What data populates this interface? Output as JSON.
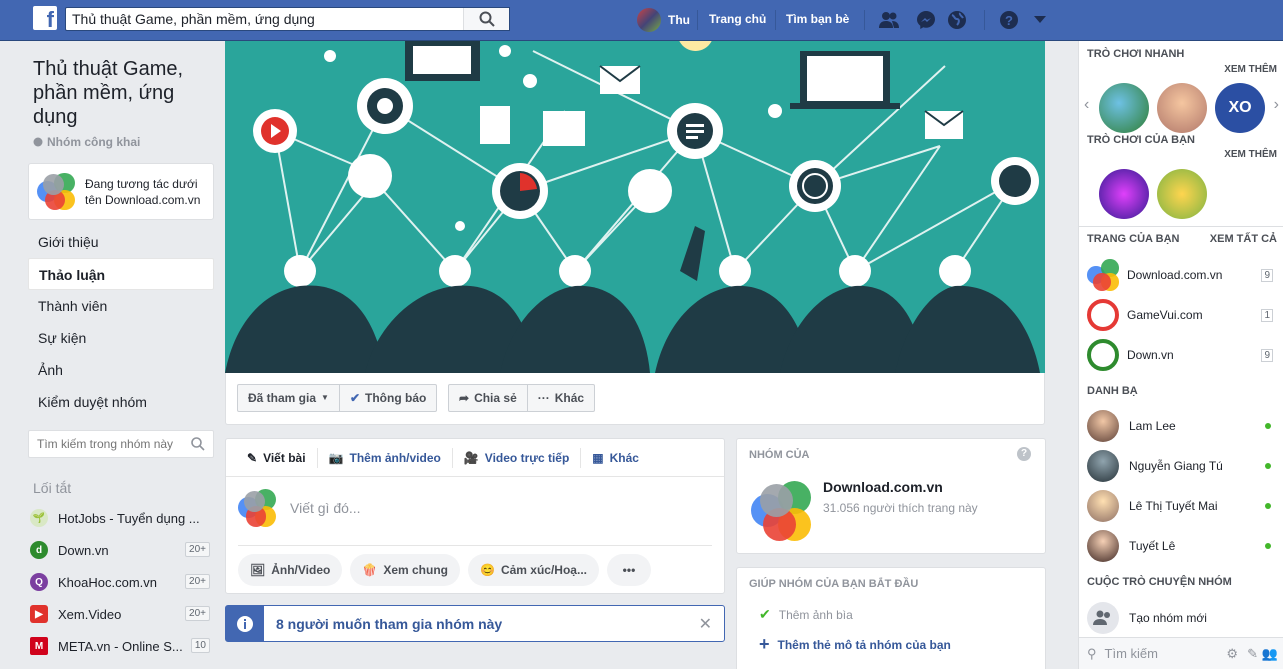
{
  "header": {
    "search_value": "Thủ thuật Game, phần mềm, ứng dụng",
    "user_name": "Thu",
    "home_label": "Trang chủ",
    "find_friends_label": "Tìm bạn bè"
  },
  "group": {
    "title": "Thủ thuật Game, phần mềm, ứng dụng",
    "privacy": "Nhóm công khai",
    "acting_as": "Đang tương tác dưới tên Download.com.vn"
  },
  "left_nav": [
    "Giới thiệu",
    "Thảo luận",
    "Thành viên",
    "Sự kiện",
    "Ảnh",
    "Kiểm duyệt nhóm"
  ],
  "left_search_placeholder": "Tìm kiếm trong nhóm này",
  "shortcuts": {
    "title": "Lối tắt",
    "items": [
      {
        "label": "HotJobs - Tuyển dụng ...",
        "badge": ""
      },
      {
        "label": "Down.vn",
        "badge": "20+"
      },
      {
        "label": "KhoaHoc.com.vn",
        "badge": "20+"
      },
      {
        "label": "Xem.Video",
        "badge": "20+"
      },
      {
        "label": "META.vn - Online S...",
        "badge": "10"
      }
    ]
  },
  "cover_actions": {
    "joined": "Đã tham gia",
    "notifications": "Thông báo",
    "share": "Chia sẻ",
    "more": "Khác"
  },
  "composer": {
    "tabs": [
      "Viết bài",
      "Thêm ảnh/video",
      "Video trực tiếp",
      "Khác"
    ],
    "placeholder": "Viết gì đó...",
    "pills": [
      "Ảnh/Video",
      "Xem chung",
      "Cảm xúc/Hoạ..."
    ]
  },
  "invite_text": "8 người muốn tham gia nhóm này",
  "group_of": {
    "header": "NHÓM CỦA",
    "page_name": "Download.com.vn",
    "likes": "31.056 người thích trang này"
  },
  "getting_started": {
    "header": "GIÚP NHÓM CỦA BẠN BẮT ĐẦU",
    "items": [
      "Thêm ảnh bìa",
      "Thêm thẻ mô tả nhóm của bạn"
    ]
  },
  "right": {
    "quick_games": "TRÒ CHƠI NHANH",
    "see_more": "XEM THÊM",
    "your_games": "TRÒ CHƠI CỦA BẠN",
    "your_pages": "TRANG CỦA BẠN",
    "see_all": "XEM TẤT CẢ",
    "pages": [
      {
        "name": "Download.com.vn",
        "count": "9"
      },
      {
        "name": "GameVui.com",
        "count": "1"
      },
      {
        "name": "Down.vn",
        "count": "9"
      }
    ],
    "contacts_title": "DANH BẠ",
    "contacts": [
      "Lam Lee",
      "Nguyễn Giang Tú",
      "Lê Thị Tuyết Mai",
      "Tuyết Lê"
    ],
    "group_chats": "CUỘC TRÒ CHUYỆN NHÓM",
    "create_group": "Tạo nhóm mới",
    "chat_search": "Tìm kiếm"
  },
  "colors": {
    "brand": "#4267b2",
    "online": "#42b72a",
    "cover_bg": "#2aa59b"
  }
}
